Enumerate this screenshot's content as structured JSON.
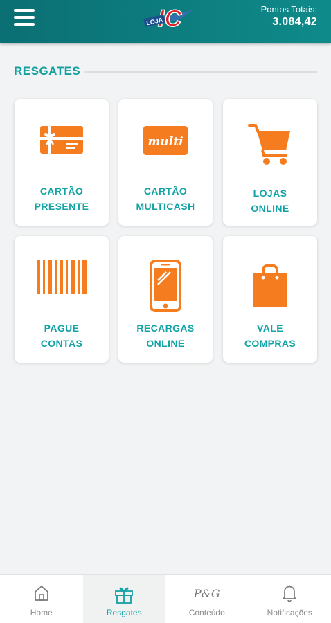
{
  "header": {
    "logo_text": "LOJA IC",
    "points_label": "Pontos Totais:",
    "points_value": "3.084,42"
  },
  "section": {
    "title": "RESGATES"
  },
  "cards": [
    {
      "line1": "CARTÃO",
      "line2": "PRESENTE",
      "icon": "gift-card-icon"
    },
    {
      "line1": "CARTÃO",
      "line2": "MULTICASH",
      "icon": "multi-card-icon",
      "icon_text": "multi"
    },
    {
      "line1": "LOJAS",
      "line2": "ONLINE",
      "icon": "shopping-cart-icon"
    },
    {
      "line1": "PAGUE",
      "line2": "CONTAS",
      "icon": "barcode-icon"
    },
    {
      "line1": "RECARGAS",
      "line2": "ONLINE",
      "icon": "smartphone-icon"
    },
    {
      "line1": "VALE",
      "line2": "COMPRAS",
      "icon": "shopping-bag-icon"
    }
  ],
  "nav": [
    {
      "label": "Home",
      "icon": "home-icon",
      "active": false
    },
    {
      "label": "Resgates",
      "icon": "gift-icon",
      "active": true
    },
    {
      "label": "Conteúdo",
      "icon": "pg-logo-icon",
      "icon_text": "P&G",
      "active": false
    },
    {
      "label": "Notificações",
      "icon": "bell-icon",
      "active": false
    }
  ],
  "colors": {
    "header": "#0f8a8a",
    "accent_teal": "#14a0a0",
    "icon_orange": "#f57c1f",
    "background": "#f1f3f4"
  }
}
